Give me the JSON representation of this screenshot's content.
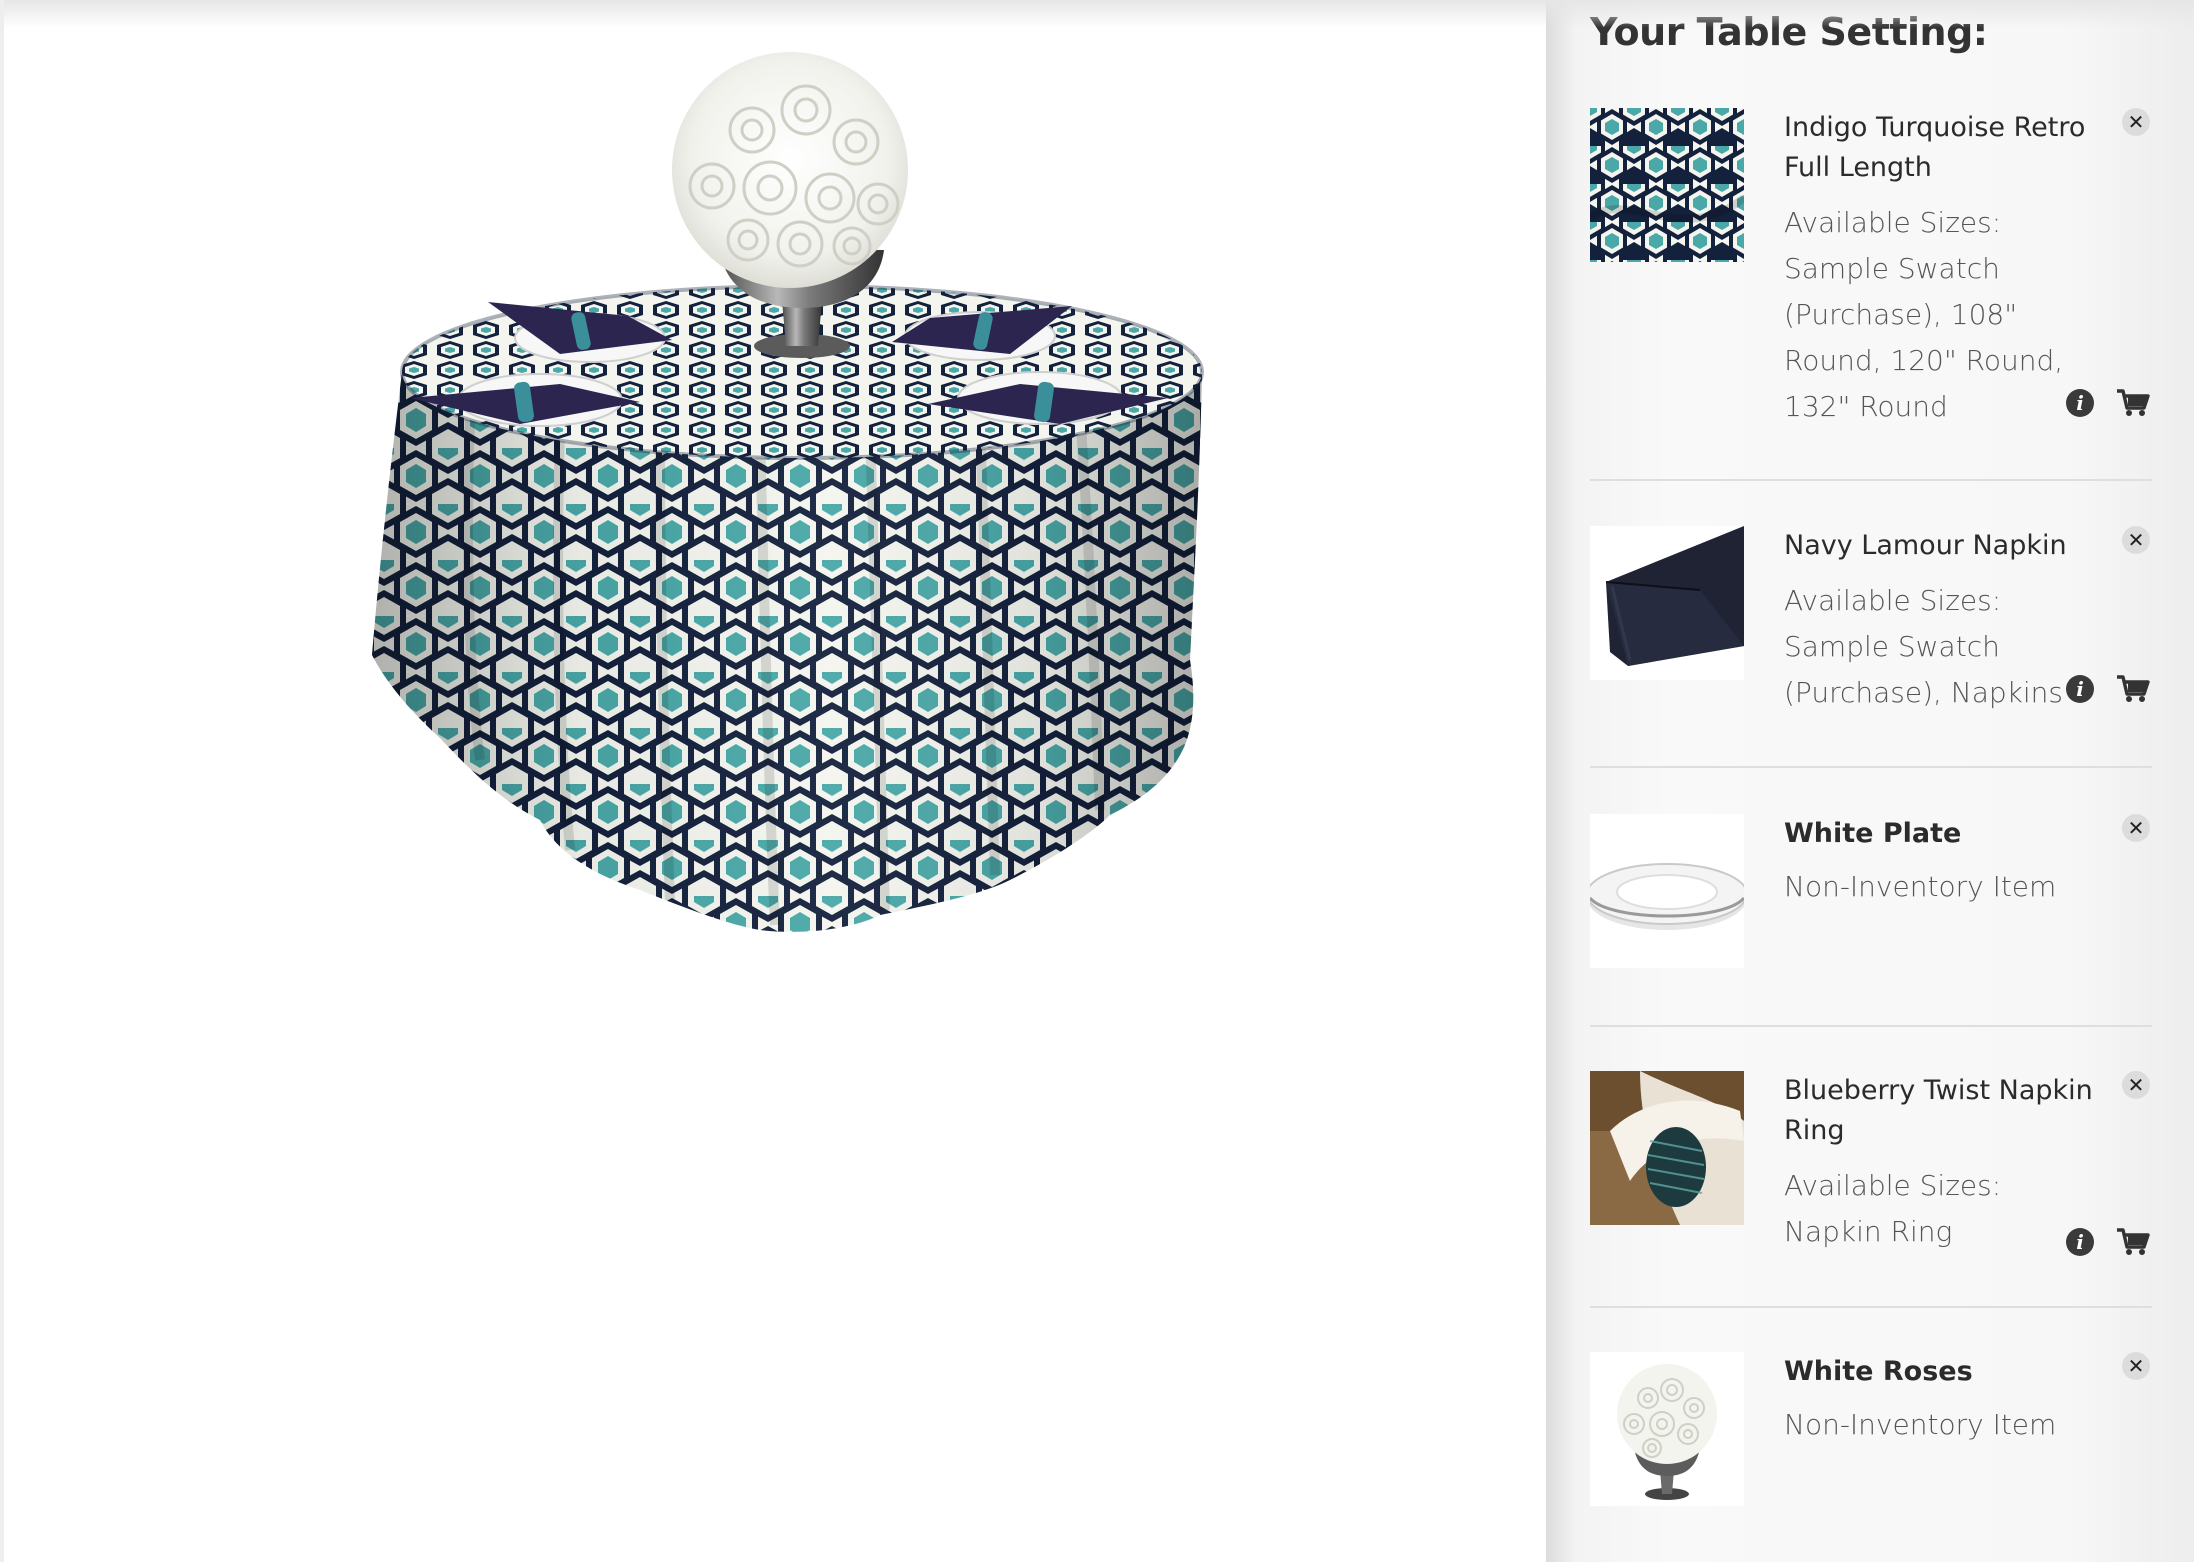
{
  "sidebar": {
    "title": "Your Table Setting:",
    "items": [
      {
        "name": "Indigo Turquoise Retro Full Length",
        "desc_label": "Available Sizes:",
        "desc_value": "Sample Swatch (Purchase), 108\" Round, 120\" Round, 132\" Round",
        "thumb_icon": "hexagon-pattern-swatch",
        "has_info": true,
        "has_cart": true
      },
      {
        "name": "Navy Lamour Napkin",
        "desc_label": "Available Sizes:",
        "desc_value": "Sample Swatch (Purchase), Napkins",
        "thumb_icon": "folded-napkin",
        "has_info": true,
        "has_cart": true
      },
      {
        "name": "White Plate",
        "desc_label": "Non-Inventory Item",
        "desc_value": "",
        "thumb_icon": "white-plate",
        "has_info": false,
        "has_cart": false
      },
      {
        "name": "Blueberry Twist Napkin Ring",
        "desc_label": "Available Sizes:",
        "desc_value": "Napkin Ring",
        "thumb_icon": "napkin-ring",
        "has_info": true,
        "has_cart": true
      },
      {
        "name": "White Roses",
        "desc_label": "Non-Inventory Item",
        "desc_value": "",
        "thumb_icon": "rose-centerpiece",
        "has_info": false,
        "has_cart": false
      }
    ],
    "remove_icon": "close-x",
    "info_icon_glyph": "i",
    "remove_glyph": "✕"
  },
  "colors": {
    "navy": "#14213d",
    "turquoise": "#4aa8a8",
    "cream": "#f3f5ee",
    "napkin": "#2c2550",
    "sidebar_bg": "#f7f7f7"
  }
}
